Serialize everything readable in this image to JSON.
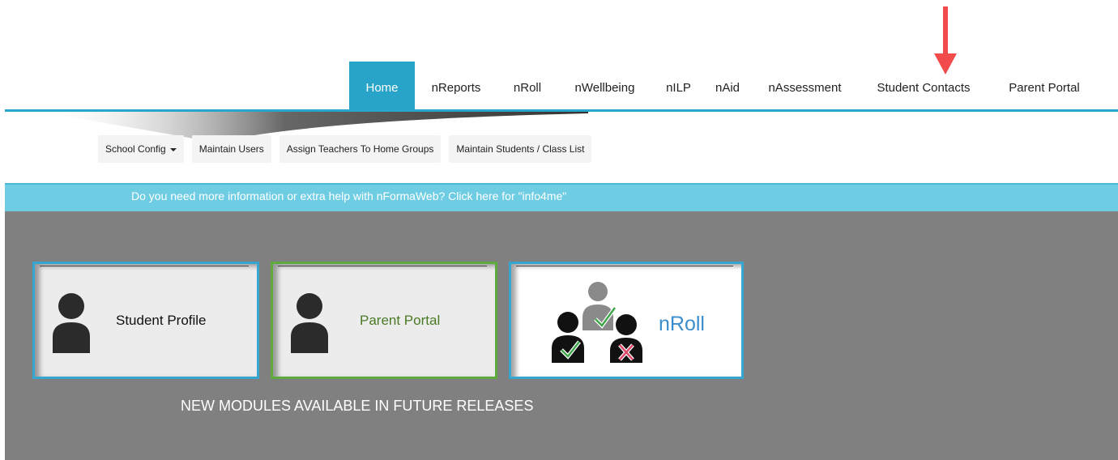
{
  "topnav": {
    "items": [
      {
        "label": "Home",
        "active": true
      },
      {
        "label": "nReports"
      },
      {
        "label": "nRoll"
      },
      {
        "label": "nWellbeing"
      },
      {
        "label": "nILP"
      },
      {
        "label": "nAid"
      },
      {
        "label": "nAssessment"
      },
      {
        "label": "Student Contacts"
      },
      {
        "label": "Parent Portal"
      }
    ],
    "accent_color": "#28a4c9"
  },
  "annotation": {
    "icon": "arrow-down-icon",
    "color": "#f24b4b"
  },
  "subnav": {
    "items": [
      {
        "label": "School Config",
        "has_dropdown": true
      },
      {
        "label": "Maintain Users"
      },
      {
        "label": "Assign Teachers To Home Groups"
      },
      {
        "label": "Maintain Students / Class List"
      }
    ]
  },
  "info_banner": {
    "text": "Do you need more information or extra help with nFormaWeb? Click here for \"info4me\"",
    "color": "#6fcde3"
  },
  "modules": [
    {
      "label": "Student Profile",
      "icon": "person-icon",
      "border_color": "#35a6d0"
    },
    {
      "label": "Parent Portal",
      "icon": "person-icon",
      "border_color": "#5cab3c"
    },
    {
      "label": "nRoll",
      "icon": "roll-call-icon",
      "border_color": "#35a6d0"
    }
  ],
  "future_modules_text": "NEW MODULES AVAILABLE IN FUTURE RELEASES"
}
